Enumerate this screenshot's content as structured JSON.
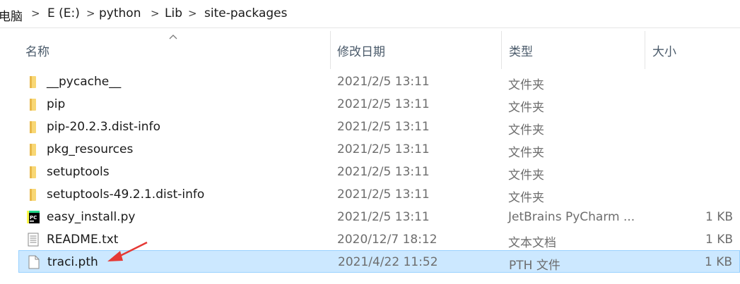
{
  "breadcrumb": {
    "items": [
      "电脑",
      "E (E:)",
      "python",
      "Lib",
      "site-packages"
    ],
    "separator": ">"
  },
  "columns": {
    "name": "名称",
    "date": "修改日期",
    "type": "类型",
    "size": "大小",
    "sorted_by": "名称"
  },
  "files": [
    {
      "name": "__pycache__",
      "date": "2021/2/5 13:11",
      "type": "文件夹",
      "size": "",
      "icon": "folder-icon"
    },
    {
      "name": "pip",
      "date": "2021/2/5 13:11",
      "type": "文件夹",
      "size": "",
      "icon": "folder-icon"
    },
    {
      "name": "pip-20.2.3.dist-info",
      "date": "2021/2/5 13:11",
      "type": "文件夹",
      "size": "",
      "icon": "folder-icon"
    },
    {
      "name": "pkg_resources",
      "date": "2021/2/5 13:11",
      "type": "文件夹",
      "size": "",
      "icon": "folder-icon"
    },
    {
      "name": "setuptools",
      "date": "2021/2/5 13:11",
      "type": "文件夹",
      "size": "",
      "icon": "folder-icon"
    },
    {
      "name": "setuptools-49.2.1.dist-info",
      "date": "2021/2/5 13:11",
      "type": "文件夹",
      "size": "",
      "icon": "folder-icon"
    },
    {
      "name": "easy_install.py",
      "date": "2021/2/5 13:11",
      "type": "JetBrains PyCharm ...",
      "size": "1 KB",
      "icon": "pycharm-file-icon"
    },
    {
      "name": "README.txt",
      "date": "2020/12/7 18:12",
      "type": "文本文档",
      "size": "1 KB",
      "icon": "text-file-icon"
    },
    {
      "name": "traci.pth",
      "date": "2021/4/22 11:52",
      "type": "PTH 文件",
      "size": "1 KB",
      "icon": "blank-file-icon"
    }
  ],
  "selected_file": "traci.pth",
  "colors": {
    "selection": "#cce8ff",
    "selection_border": "#99d1ff",
    "folder": "#f8d775",
    "annotation_arrow": "#e53935"
  }
}
